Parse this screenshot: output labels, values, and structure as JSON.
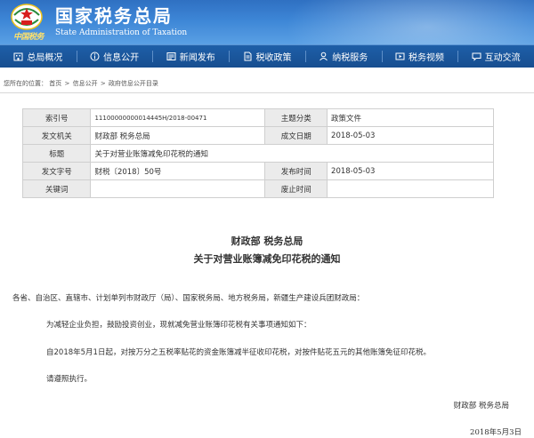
{
  "header": {
    "title": "国家税务总局",
    "subtitle": "State Administration of Taxation",
    "tagline": "中国税务",
    "colors": {
      "primary": "#2f70c2",
      "nav": "#1e5fa8",
      "tagline": "#ffe16a"
    }
  },
  "nav": {
    "items": [
      {
        "label": "总局概况",
        "icon": "building-icon"
      },
      {
        "label": "信息公开",
        "icon": "info-icon"
      },
      {
        "label": "新闻发布",
        "icon": "news-icon"
      },
      {
        "label": "税收政策",
        "icon": "policy-icon"
      },
      {
        "label": "纳税服务",
        "icon": "service-icon"
      },
      {
        "label": "税务视频",
        "icon": "video-icon"
      },
      {
        "label": "互动交流",
        "icon": "chat-icon"
      }
    ]
  },
  "breadcrumb": {
    "prefix": "您所在的位置：",
    "items": [
      "首页",
      "信息公开",
      "政府信息公开目录"
    ],
    "sep": ">"
  },
  "meta": {
    "index_label": "索引号",
    "index_value": "11100000000014445H/2018-00471",
    "topic_label": "主题分类",
    "topic_value": "政策文件",
    "issuer_label": "发文机关",
    "issuer_value": "财政部 税务总局",
    "date_label": "成文日期",
    "date_value": "2018-05-03",
    "title_label": "标题",
    "title_value": "关于对营业账簿减免印花税的通知",
    "docno_label": "发文字号",
    "docno_value": "财税〔2018〕50号",
    "pubdate_label": "发布时间",
    "pubdate_value": "2018-05-03",
    "keywords_label": "关键词",
    "keywords_value": "",
    "abolish_label": "废止时间",
    "abolish_value": ""
  },
  "document": {
    "issuer": "财政部  税务总局",
    "title": "关于对营业账簿减免印花税的通知",
    "paragraphs": [
      "各省、自治区、直辖市、计划单列市财政厅（局）、国家税务局、地方税务局，新疆生产建设兵团财政局：",
      "为减轻企业负担，鼓励投资创业，现就减免营业账簿印花税有关事项通知如下：",
      "自2018年5月1日起，对按万分之五税率贴花的资金账簿减半征收印花税，对按件贴花五元的其他账簿免征印花税。",
      "请遵照执行。"
    ],
    "signature": "财政部  税务总局",
    "date": "2018年5月3日"
  }
}
